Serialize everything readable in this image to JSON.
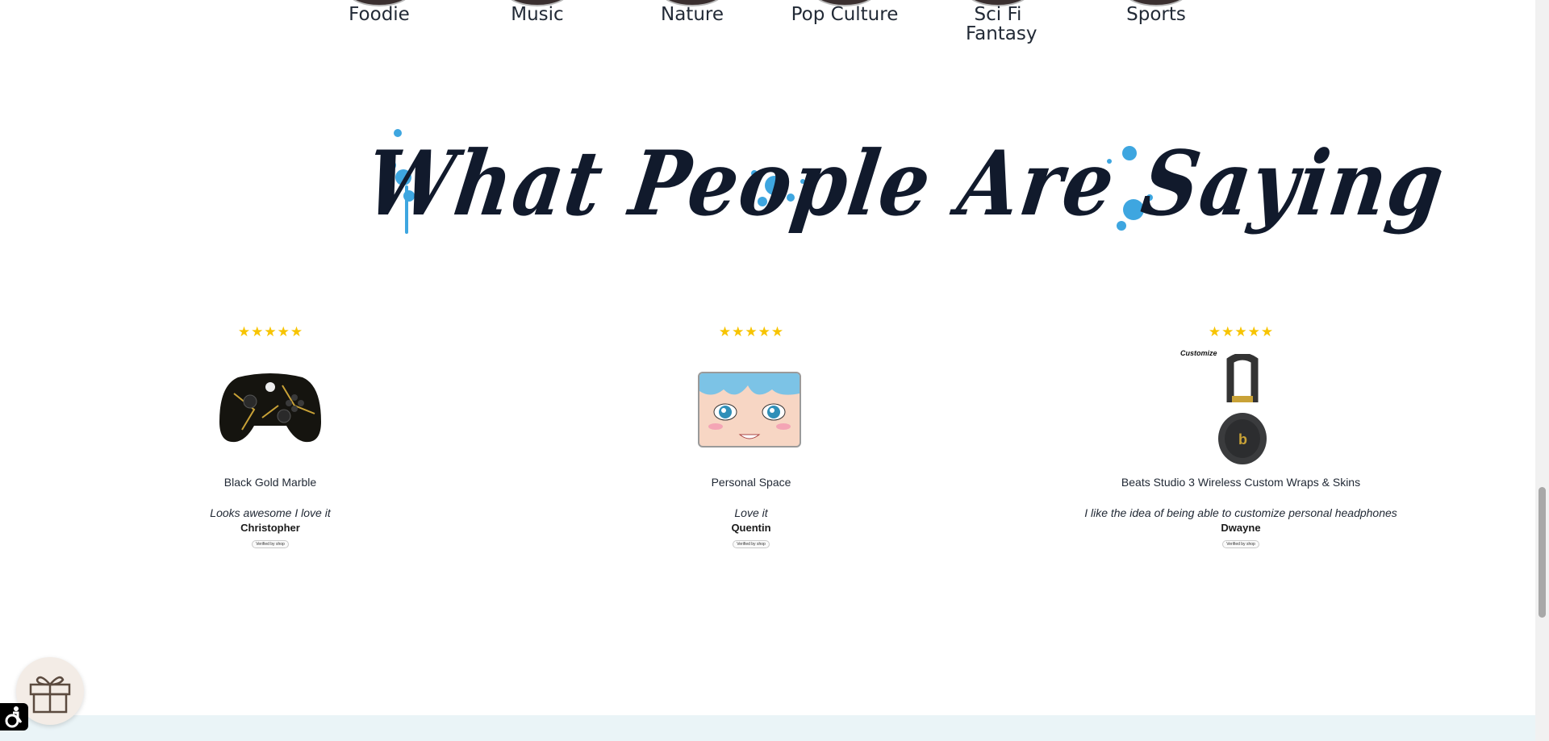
{
  "categories": [
    {
      "label": "Foodie",
      "icon": "foodie-thumbnail"
    },
    {
      "label": "Music",
      "icon": "music-thumbnail"
    },
    {
      "label": "Nature",
      "icon": "nature-thumbnail"
    },
    {
      "label": "Pop Culture",
      "icon": "pop-culture-thumbnail"
    },
    {
      "label": "Sci Fi Fantasy",
      "icon": "sci-fi-fantasy-thumbnail"
    },
    {
      "label": "Sports",
      "icon": "sports-thumbnail"
    }
  ],
  "section": {
    "heading": "What People Are Saying",
    "accent_color": "#3ea6e0",
    "text_color": "#111a2c"
  },
  "reviews": [
    {
      "rating": 5,
      "product": "Black Gold Marble",
      "quote": "Looks awesome I love it",
      "author": "Christopher",
      "verified": "Verified by shop"
    },
    {
      "rating": 5,
      "product": "Personal Space",
      "quote": "Love it",
      "author": "Quentin",
      "verified": "Verified by shop"
    },
    {
      "rating": 5,
      "product": "Beats Studio 3 Wireless Custom Wraps & Skins",
      "quote": "I like the idea of being able to customize personal headphones",
      "author": "Dwayne",
      "verified": "Verified by shop",
      "badge": "Customize"
    }
  ],
  "widgets": {
    "gift_icon": "gift-icon",
    "accessibility_icon": "accessibility-icon"
  },
  "colors": {
    "star": "#f7c400",
    "footer_band": "#eaf4f7"
  }
}
